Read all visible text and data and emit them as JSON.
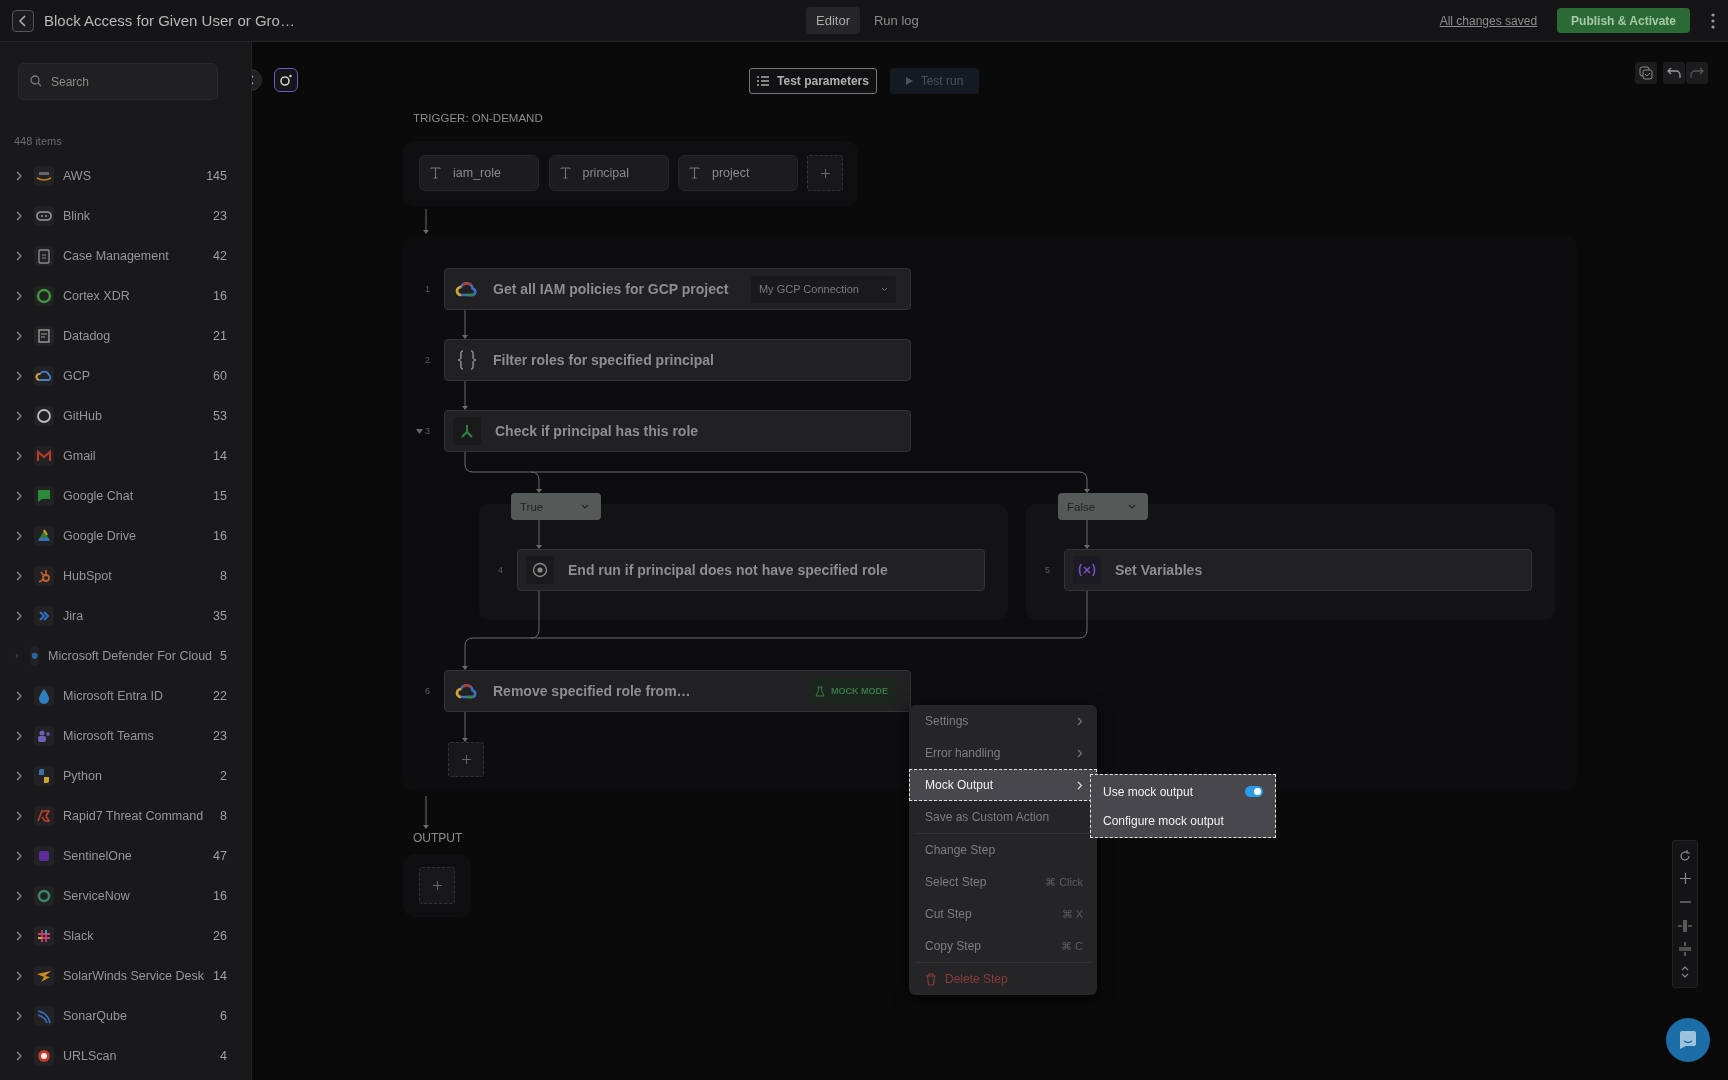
{
  "header": {
    "title": "Block Access for Given User or Gro…",
    "tabs": [
      {
        "label": "Editor",
        "selected": true
      },
      {
        "label": "Run log",
        "selected": false
      }
    ],
    "save_status": "All changes saved",
    "publish_button": "Publish & Activate"
  },
  "sidebar": {
    "search_placeholder": "Search",
    "item_count": "448 items",
    "items": [
      {
        "name": "AWS",
        "count": "145",
        "expanded": false
      },
      {
        "name": "Blink",
        "count": "23",
        "expanded": false
      },
      {
        "name": "Case Management",
        "count": "42",
        "expanded": false
      },
      {
        "name": "Cortex XDR",
        "count": "16",
        "expanded": false
      },
      {
        "name": "Datadog",
        "count": "21",
        "expanded": false
      },
      {
        "name": "GCP",
        "count": "60",
        "expanded": false
      },
      {
        "name": "GitHub",
        "count": "53",
        "expanded": false
      },
      {
        "name": "Gmail",
        "count": "14",
        "expanded": false
      },
      {
        "name": "Google Chat",
        "count": "15",
        "expanded": false
      },
      {
        "name": "Google Drive",
        "count": "16",
        "expanded": false
      },
      {
        "name": "HubSpot",
        "count": "8",
        "expanded": false
      },
      {
        "name": "Jira",
        "count": "35",
        "expanded": false
      },
      {
        "name": "Microsoft Defender For Cloud",
        "count": "5",
        "expanded": false
      },
      {
        "name": "Microsoft Entra ID",
        "count": "22",
        "expanded": false
      },
      {
        "name": "Microsoft Teams",
        "count": "23",
        "expanded": false
      },
      {
        "name": "Python",
        "count": "2",
        "expanded": false
      },
      {
        "name": "Rapid7 Threat Command",
        "count": "8",
        "expanded": false
      },
      {
        "name": "SentinelOne",
        "count": "47",
        "expanded": false
      },
      {
        "name": "ServiceNow",
        "count": "16",
        "expanded": false
      },
      {
        "name": "Slack",
        "count": "26",
        "expanded": false
      },
      {
        "name": "SolarWinds Service Desk",
        "count": "14",
        "expanded": false
      },
      {
        "name": "SonarQube",
        "count": "6",
        "expanded": false
      },
      {
        "name": "URLScan",
        "count": "4",
        "expanded": false
      }
    ]
  },
  "toolbar": {
    "test_parameters": "Test parameters",
    "test_run": {
      "label": "Test run",
      "disabled": true
    }
  },
  "workflow": {
    "trigger_label": "TRIGGER: ON-DEMAND",
    "parameters": [
      {
        "name": "iam_role"
      },
      {
        "name": "principal"
      },
      {
        "name": "project"
      }
    ],
    "steps": [
      {
        "number": "1",
        "title": "Get all IAM policies for GCP project",
        "kind": "gcp",
        "connection": "My GCP Connection"
      },
      {
        "number": "2",
        "title": "Filter roles for specified principal",
        "kind": "code"
      },
      {
        "number": "3",
        "title": "Check if principal has this role",
        "kind": "condition",
        "expanded": true,
        "branches": [
          {
            "label": "True",
            "steps": [
              {
                "number": "4",
                "title": "End run if principal does not have specified role",
                "kind": "stop"
              }
            ]
          },
          {
            "label": "False",
            "steps": [
              {
                "number": "5",
                "title": "Set Variables",
                "kind": "variables"
              }
            ]
          }
        ]
      },
      {
        "number": "6",
        "title": "Remove specified role from…",
        "kind": "gcp",
        "mock_badge": "MOCK MODE"
      }
    ],
    "output_label": "OUTPUT"
  },
  "context_menu": {
    "items": [
      {
        "label": "Settings",
        "kind": "submenu",
        "selected": false
      },
      {
        "label": "Error handling",
        "kind": "submenu",
        "selected": false
      },
      {
        "label": "Mock Output",
        "kind": "submenu",
        "selected": true,
        "submenu": [
          {
            "label": "Use mock output",
            "kind": "toggle",
            "on": true
          },
          {
            "label": "Configure mock output",
            "kind": "action"
          }
        ]
      },
      {
        "label": "Save as Custom Action",
        "kind": "action",
        "selected": false
      },
      {
        "kind": "divider"
      },
      {
        "label": "Change Step",
        "kind": "action",
        "selected": false
      },
      {
        "label": "Select Step",
        "kind": "action",
        "shortcut": "⌘ Click",
        "selected": false
      },
      {
        "label": "Cut Step",
        "kind": "action",
        "shortcut": "⌘ X",
        "selected": false
      },
      {
        "label": "Copy Step",
        "kind": "action",
        "shortcut": "⌘ C",
        "selected": false
      },
      {
        "kind": "divider"
      },
      {
        "label": "Delete Step",
        "kind": "danger",
        "selected": false
      }
    ]
  }
}
